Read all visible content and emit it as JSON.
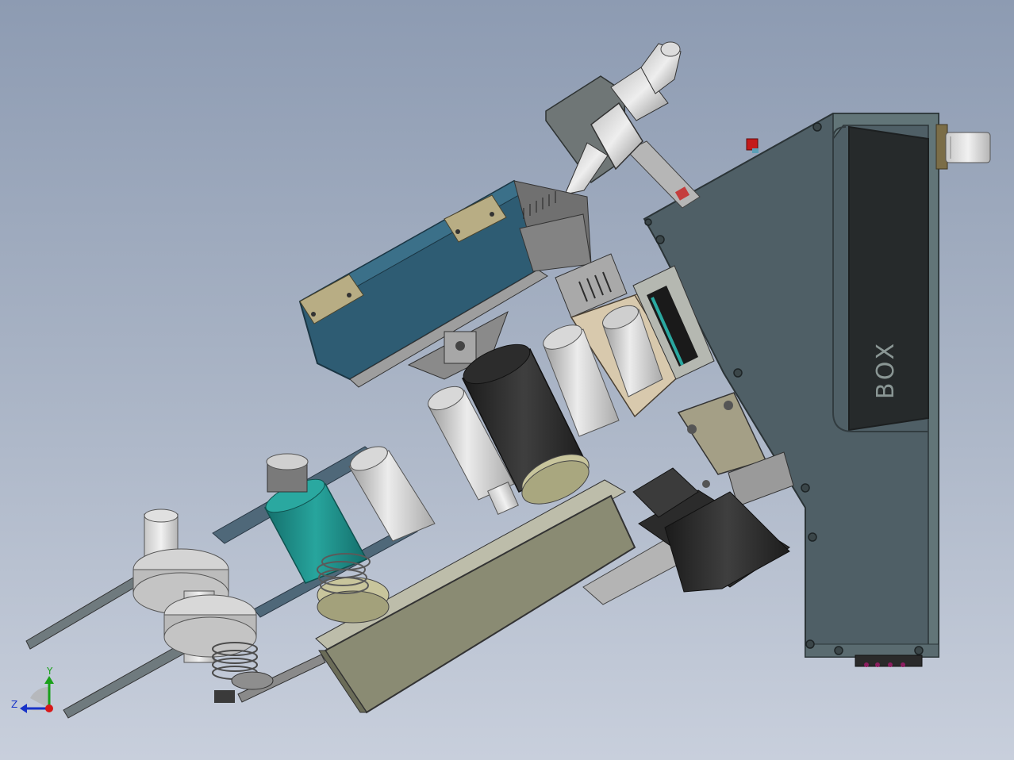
{
  "model": {
    "housing_label": "BOX"
  },
  "triad": {
    "y_label": "Y",
    "z_label": "Z",
    "colors": {
      "x": "#d81818",
      "y": "#1aa01a",
      "z": "#1833c8"
    }
  },
  "colors": {
    "background_top": "#8d9bb2",
    "background_bottom": "#c8cfdc",
    "housing": "#4f5f66",
    "housing_frame": "#5e7073",
    "blue_box": "#2e5c73",
    "khaki": "#8a8b73",
    "teal": "#1e8e88",
    "motor": "#2a2a2a",
    "cylinder": "#d4d4d4",
    "hinge": "#b8ad84",
    "accent_red": "#c41b1b"
  }
}
